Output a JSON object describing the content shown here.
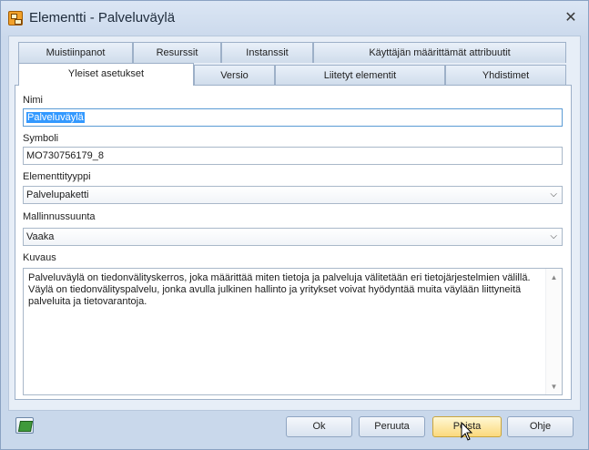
{
  "window": {
    "title": "Elementti - Palveluväylä",
    "close_symbol": "✕"
  },
  "tabs": {
    "row1": [
      "Muistiinpanot",
      "Resurssit",
      "Instanssit",
      "Käyttäjän määrittämät attribuutit"
    ],
    "row2": [
      "Yleiset asetukset",
      "Versio",
      "Liitetyt elementit",
      "Yhdistimet"
    ],
    "active": "Yleiset asetukset"
  },
  "form": {
    "name_label": "Nimi",
    "name_value": "Palveluväylä",
    "symbol_label": "Symboli",
    "symbol_value": "MO730756179_8",
    "type_label": "Elementtityyppi",
    "type_value": "Palvelupaketti",
    "direction_label": "Mallinnussuunta",
    "direction_value": "Vaaka",
    "description_label": "Kuvaus",
    "description_value": "Palveluväylä on tiedonvälityskerros, joka määrittää miten tietoja ja palveluja välitetään eri tietojärjestelmien välillä.\nVäylä on tiedonvälityspalvelu, jonka avulla julkinen hallinto ja yritykset voivat hyödyntää muita väylään liittyneitä\npalveluita ja tietovarantoja."
  },
  "buttons": {
    "ok": "Ok",
    "cancel": "Peruuta",
    "delete": "Poista",
    "help": "Ohje"
  },
  "icons": {
    "app": "element-app-icon",
    "book": "book-icon",
    "chevron": "chevron-down-icon"
  }
}
